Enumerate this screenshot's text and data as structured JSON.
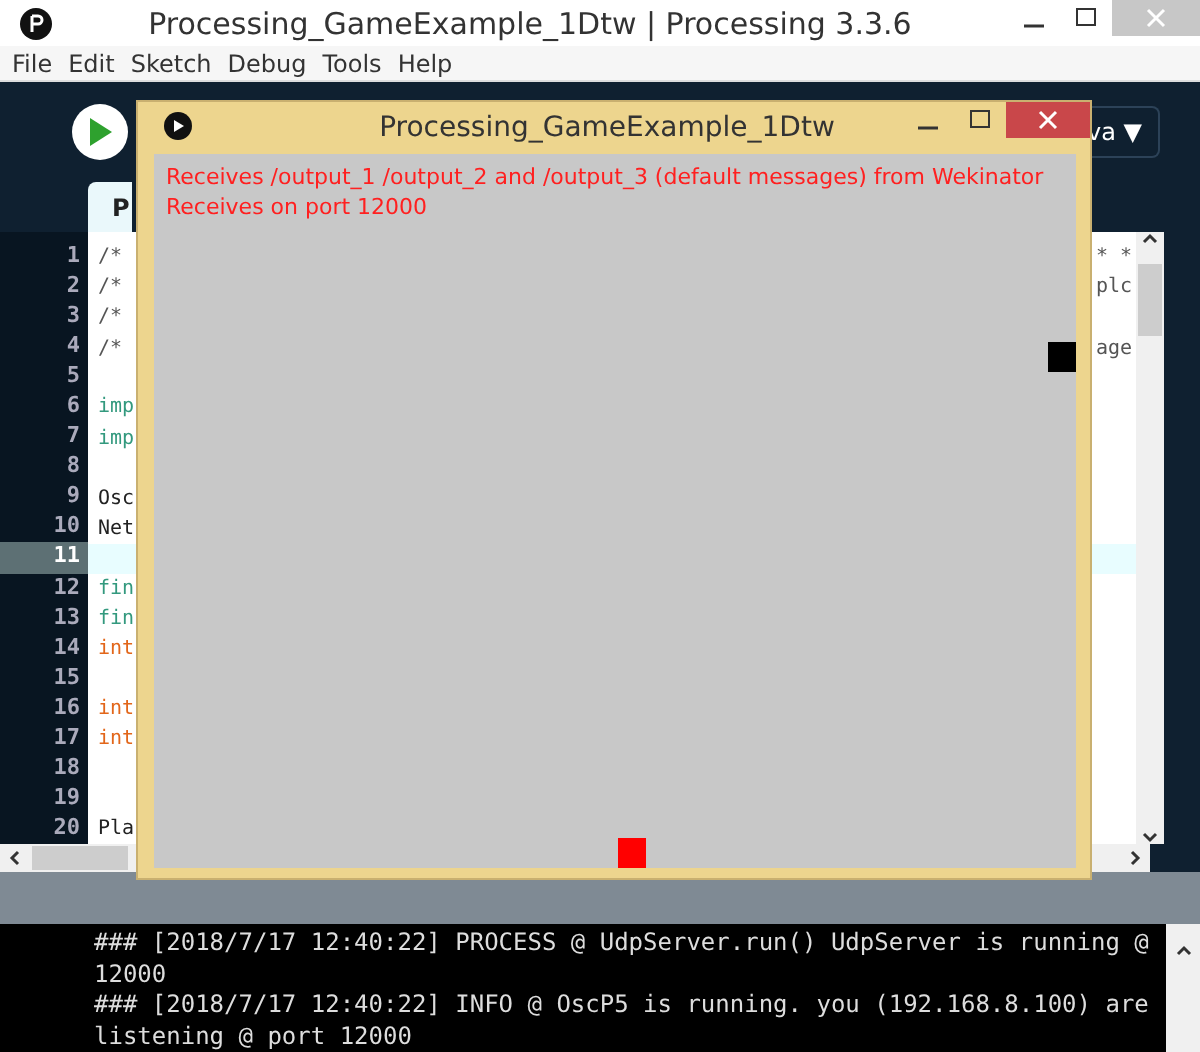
{
  "window": {
    "title": "Processing_GameExample_1Dtw | Processing 3.3.6"
  },
  "menu": [
    "File",
    "Edit",
    "Sketch",
    "Debug",
    "Tools",
    "Help"
  ],
  "toolbar": {
    "mode": "va ▼"
  },
  "tab": {
    "label": "P"
  },
  "editor": {
    "lines": [
      {
        "number": "1",
        "text": "/*",
        "kind": "comment",
        "tail": "* *",
        "selected": false
      },
      {
        "number": "2",
        "text": "/*",
        "kind": "comment",
        "tail": "plc",
        "selected": false
      },
      {
        "number": "3",
        "text": "/*",
        "kind": "comment",
        "selected": false
      },
      {
        "number": "4",
        "text": "/*",
        "kind": "comment",
        "tail": "age",
        "selected": false
      },
      {
        "number": "5",
        "selected": false
      },
      {
        "number": "6",
        "text": "imp",
        "kind": "keyword",
        "selected": false
      },
      {
        "number": "7",
        "text": "imp",
        "kind": "keyword",
        "selected": false
      },
      {
        "number": "8",
        "selected": false
      },
      {
        "number": "9",
        "text": "Osc",
        "kind": "plain",
        "selected": false
      },
      {
        "number": "10",
        "text": "Net",
        "kind": "plain",
        "selected": false
      },
      {
        "number": "11",
        "selected": true
      },
      {
        "number": "12",
        "text": "fin",
        "kind": "keyword",
        "selected": false
      },
      {
        "number": "13",
        "text": "fin",
        "kind": "keyword",
        "selected": false
      },
      {
        "number": "14",
        "text": "int",
        "kind": "type",
        "selected": false
      },
      {
        "number": "15",
        "selected": false
      },
      {
        "number": "16",
        "text": "int",
        "kind": "type",
        "selected": false
      },
      {
        "number": "17",
        "text": "int",
        "kind": "type",
        "selected": false
      },
      {
        "number": "18",
        "selected": false
      },
      {
        "number": "19",
        "selected": false
      },
      {
        "number": "20",
        "text": "Pla",
        "kind": "plain",
        "selected": false
      }
    ]
  },
  "console": [
    "### [2018/7/17 12:40:22] PROCESS @ UdpServer.run() UdpServer is running @",
    "12000",
    "### [2018/7/17 12:40:22] INFO @ OscP5 is running. you (192.168.8.100) are",
    "listening @ port 12000"
  ],
  "sketch_window": {
    "title": "Processing_GameExample_1Dtw",
    "messages": [
      "Receives /output_1 /output_2 and /output_3 (default messages) from Wekinator",
      "Receives on port 12000"
    ],
    "sprites": [
      {
        "color": "#000000"
      },
      {
        "color": "#ff0000"
      }
    ]
  }
}
